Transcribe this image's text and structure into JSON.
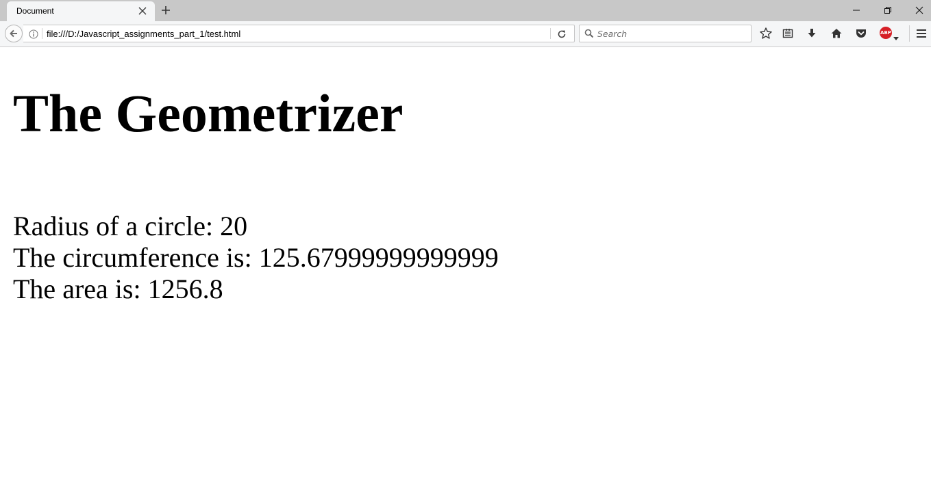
{
  "browser": {
    "tab_title": "Document",
    "url": "file:///D:/Javascript_assignments_part_1/test.html",
    "search_placeholder": "Search",
    "abp_label": "ABP"
  },
  "page": {
    "heading": "The Geometrizer",
    "radius_line": "Radius of a circle: 20",
    "circumference_line": "The circumference is: 125.67999999999999",
    "area_line": "The area is: 1256.8"
  },
  "colors": {
    "abp_red": "#d61f26",
    "tabstrip": "#c8c8c8",
    "toolbar": "#f5f6f7"
  }
}
